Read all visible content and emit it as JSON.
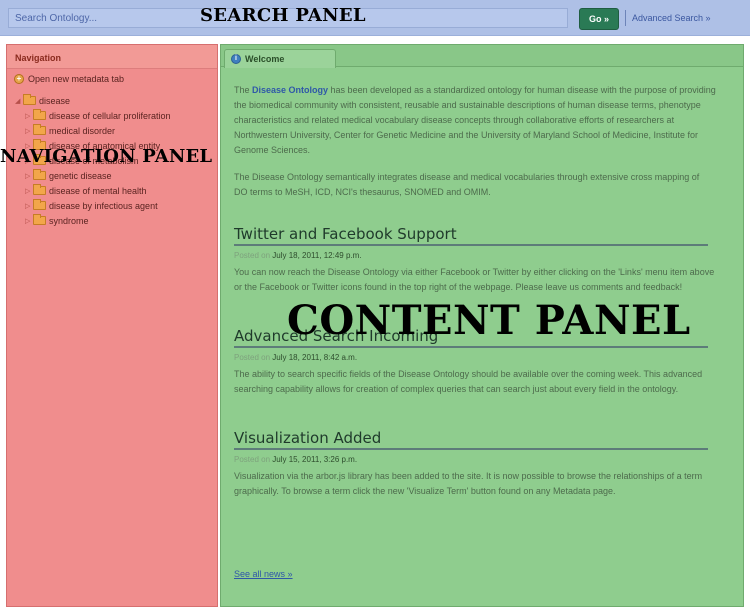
{
  "search": {
    "placeholder": "Search Ontology...",
    "overlay_label": "SEARCH PANEL",
    "go_label": "Go »",
    "advanced_label": "Advanced Search »"
  },
  "navigation": {
    "title": "Navigation",
    "open_tab_label": "Open new metadata tab",
    "overlay_label": "NAVIGATION PANEL",
    "root": "disease",
    "children": [
      "disease of cellular proliferation",
      "medical disorder",
      "disease of anatomical entity",
      "disease of metabolism",
      "genetic disease",
      "disease of mental health",
      "disease by infectious agent",
      "syndrome"
    ]
  },
  "content": {
    "tab_label": "Welcome",
    "overlay_label": "CONTENT PANEL",
    "intro_prefix": "The ",
    "intro_link": "Disease Ontology",
    "intro_rest": " has been developed as a standardized ontology for human disease with the purpose of providing the biomedical community with consistent, reusable and sustainable descriptions of human disease terms, phenotype characteristics and related medical vocabulary disease concepts through collaborative efforts of researchers at Northwestern University, Center for Genetic Medicine and the University of Maryland School of Medicine, Institute for Genome Sciences.",
    "intro2": "The Disease Ontology semantically integrates disease and medical vocabularies through extensive cross mapping of DO terms to MeSH, ICD, NCI's thesaurus, SNOMED and OMIM.",
    "news": [
      {
        "title": "Twitter and Facebook Support",
        "posted": "Posted on",
        "date": "July 18, 2011, 12:49 p.m.",
        "body": "You can now reach the Disease Ontology via either Facebook or Twitter by either clicking on the 'Links' menu item above or the Facebook or Twitter icons found in the top right of the webpage. Please leave us comments and feedback!"
      },
      {
        "title": "Advanced Search Incoming",
        "posted": "Posted on",
        "date": "July 18, 2011, 8:42 a.m.",
        "body": "The ability to search specific fields of the Disease Ontology should be available over the coming week. This advanced searching capability allows for creation of complex queries that can search just about every field in the ontology."
      },
      {
        "title": "Visualization Added",
        "posted": "Posted on",
        "date": "July 15, 2011, 3:26 p.m.",
        "body": "Visualization via the arbor.js library has been added to the site. It is now possible to browse the relationships of a term graphically. To browse a term click the new 'Visualize Term' button found on any Metadata page."
      }
    ],
    "see_all_label": "See all news »"
  }
}
